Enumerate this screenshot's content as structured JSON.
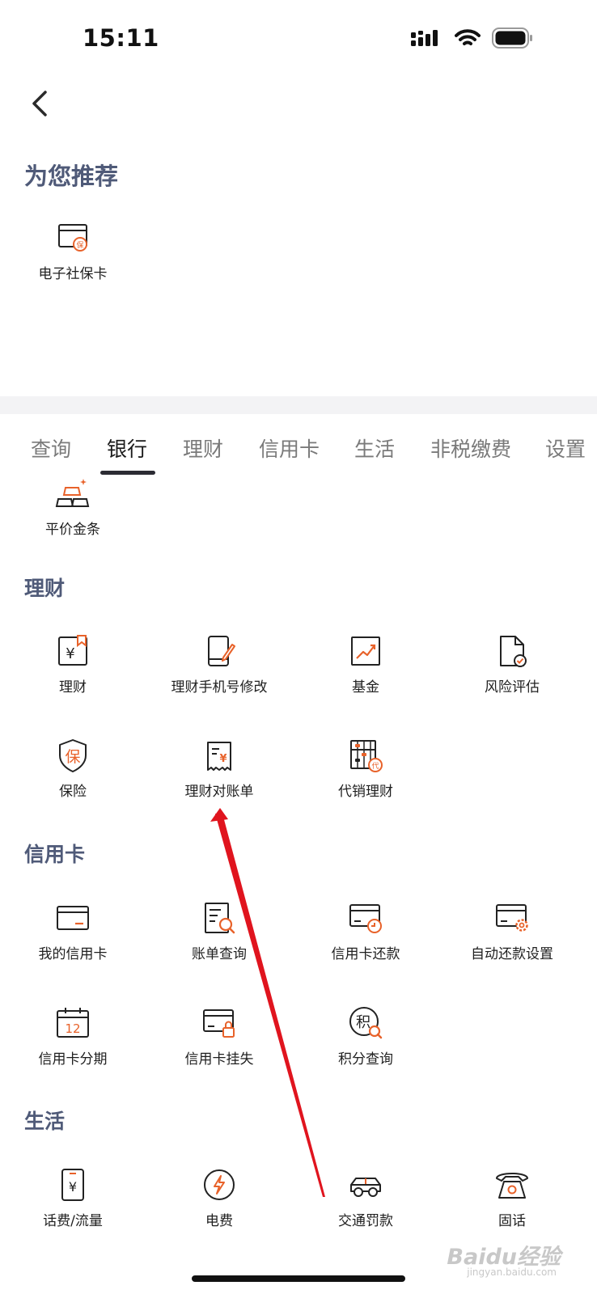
{
  "status_bar": {
    "time": "15:11"
  },
  "recommend": {
    "title": "为您推荐",
    "items": [
      {
        "label": "电子社保卡",
        "icon": "social-security-card-icon"
      }
    ]
  },
  "tabs": [
    {
      "label": "查询"
    },
    {
      "label": "银行",
      "active": true
    },
    {
      "label": "理财"
    },
    {
      "label": "信用卡"
    },
    {
      "label": "生活"
    },
    {
      "label": "非税缴费"
    },
    {
      "label": "设置"
    }
  ],
  "bank": {
    "items": [
      {
        "label": "平价金条",
        "icon": "gold-bars-icon"
      }
    ]
  },
  "wealth": {
    "title": "理财",
    "items": [
      {
        "label": "理财",
        "icon": "wealth-icon"
      },
      {
        "label": "理财手机号修改",
        "icon": "phone-edit-icon"
      },
      {
        "label": "基金",
        "icon": "fund-chart-icon"
      },
      {
        "label": "风险评估",
        "icon": "risk-assessment-icon"
      },
      {
        "label": "保险",
        "icon": "insurance-shield-icon"
      },
      {
        "label": "理财对账单",
        "icon": "statement-icon"
      },
      {
        "label": "代销理财",
        "icon": "abacus-icon"
      }
    ]
  },
  "credit": {
    "title": "信用卡",
    "items": [
      {
        "label": "我的信用卡",
        "icon": "credit-card-icon"
      },
      {
        "label": "账单查询",
        "icon": "bill-search-icon"
      },
      {
        "label": "信用卡还款",
        "icon": "card-repay-icon"
      },
      {
        "label": "自动还款设置",
        "icon": "card-settings-icon"
      },
      {
        "label": "信用卡分期",
        "icon": "calendar-12-icon"
      },
      {
        "label": "信用卡挂失",
        "icon": "card-lock-icon"
      },
      {
        "label": "积分查询",
        "icon": "points-search-icon"
      }
    ],
    "calendar_day": "12",
    "points_char": "积"
  },
  "life": {
    "title": "生活",
    "items": [
      {
        "label": "话费/流量",
        "icon": "phone-bill-icon"
      },
      {
        "label": "电费",
        "icon": "electricity-icon"
      },
      {
        "label": "交通罚款",
        "icon": "car-icon"
      },
      {
        "label": "固话",
        "icon": "landline-phone-icon"
      }
    ]
  },
  "icon_glyphs": {
    "social": "保",
    "yuan": "¥",
    "insure": "保",
    "dai": "代"
  },
  "watermark": {
    "brand": "Baidu经验",
    "url": "jingyan.baidu.com"
  },
  "colors": {
    "accent": "#e8622a",
    "title": "#4f5a78",
    "arrow": "#e0141e"
  }
}
